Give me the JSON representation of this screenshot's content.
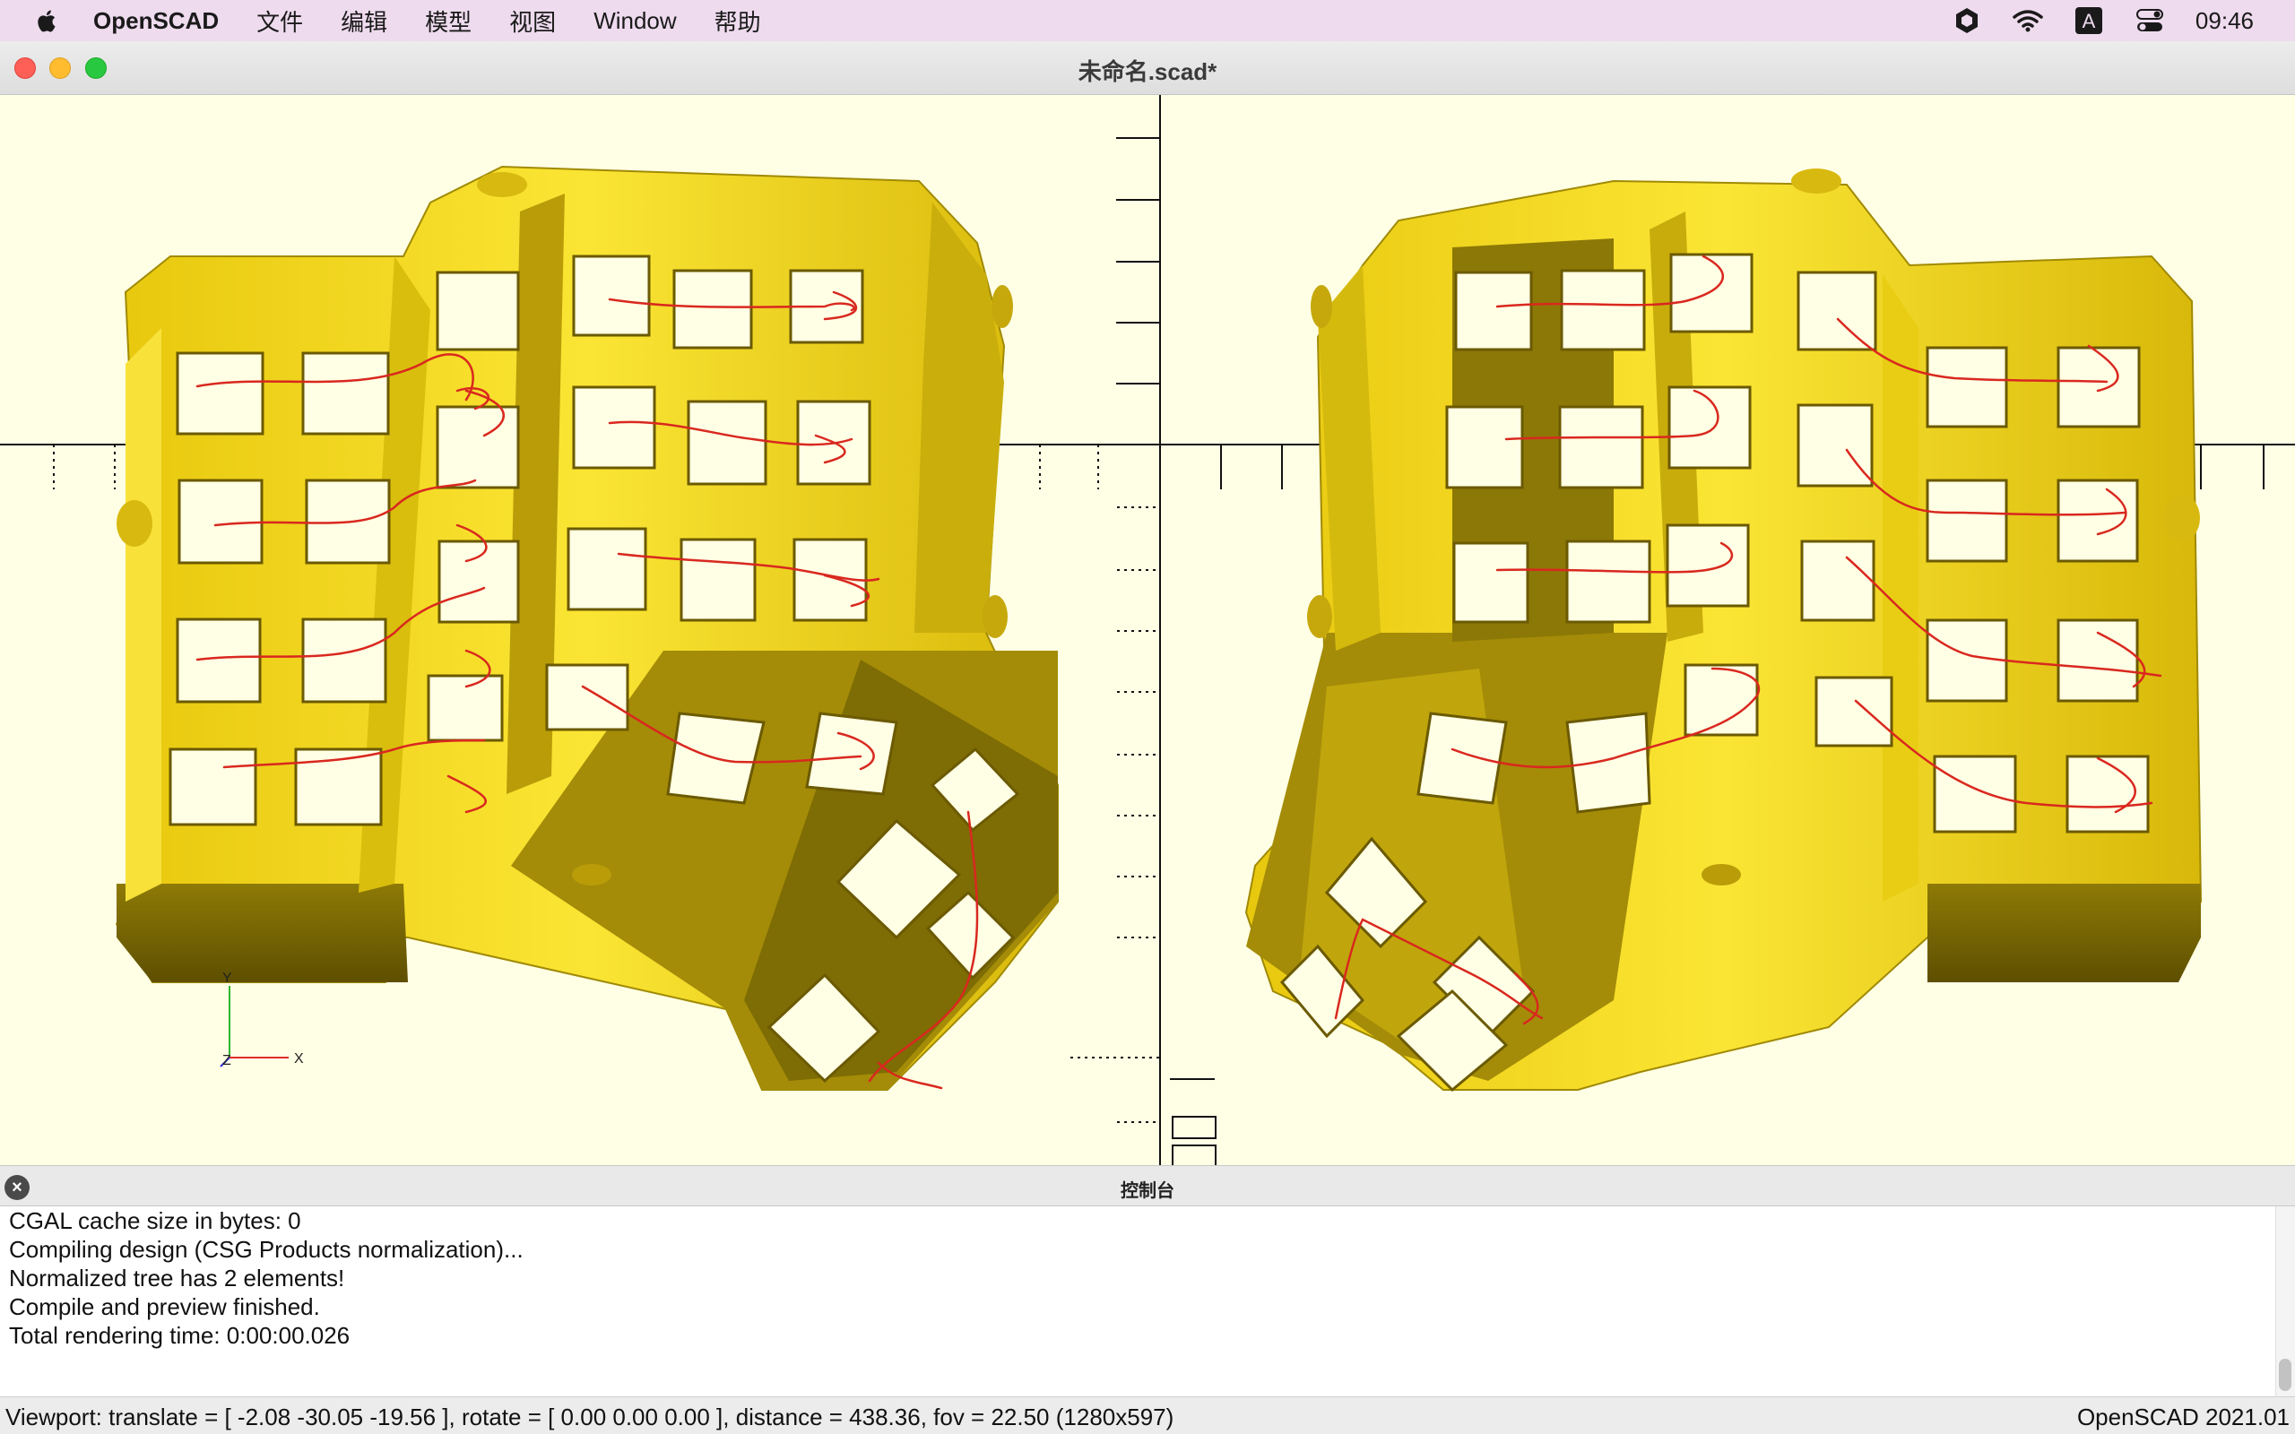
{
  "menubar": {
    "app_name": "OpenSCAD",
    "items": [
      "文件",
      "编辑",
      "模型",
      "视图",
      "Window",
      "帮助"
    ],
    "tray_icons": [
      "hexagon-shield-icon",
      "wifi-icon",
      "input-method-icon",
      "control-center-icon"
    ],
    "input_method_label": "A",
    "clock": "09:46"
  },
  "window": {
    "title": "未命名.scad*"
  },
  "viewport": {
    "background_color": "#ffffe5",
    "model_color": "#f2d816",
    "stroke_color": "#e3342f",
    "axis_labels": {
      "x": "X",
      "y": "Y",
      "z": "Z"
    }
  },
  "console": {
    "title": "控制台",
    "lines": [
      "CGAL cache size in bytes: 0",
      "Compiling design (CSG Products normalization)...",
      "Normalized tree has 2 elements!",
      "Compile and preview finished.",
      "Total rendering time: 0:00:00.026"
    ]
  },
  "statusbar": {
    "viewport_info": "Viewport: translate = [ -2.08 -30.05 -19.56 ], rotate = [ 0.00 0.00 0.00 ], distance = 438.36, fov = 22.50 (1280x597)",
    "version": "OpenSCAD 2021.01"
  }
}
